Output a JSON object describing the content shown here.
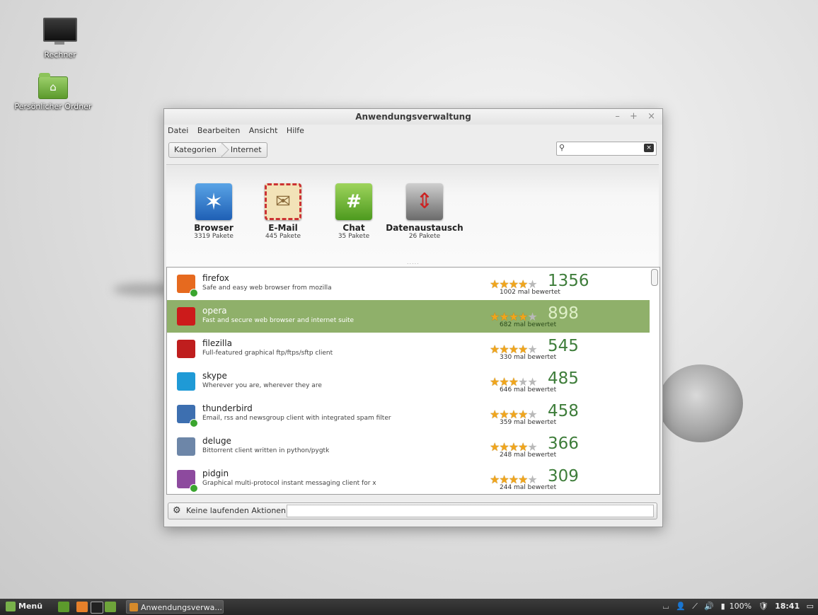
{
  "desktop": {
    "icons": [
      {
        "label": "Rechner"
      },
      {
        "label": "Persönlicher Ordner"
      }
    ]
  },
  "window": {
    "title": "Anwendungsverwaltung",
    "controls": {
      "minimize": "–",
      "maximize": "+",
      "close": "×"
    },
    "menu": [
      "Datei",
      "Bearbeiten",
      "Ansicht",
      "Hilfe"
    ],
    "breadcrumb": [
      "Kategorien",
      "Internet"
    ],
    "search": {
      "value": "",
      "placeholder": ""
    },
    "grip": ".....",
    "categories": [
      {
        "name": "Browser",
        "count": "3319 Pakete",
        "icon": "browser-icon"
      },
      {
        "name": "E-Mail",
        "count": "445 Pakete",
        "icon": "mail-icon"
      },
      {
        "name": "Chat",
        "count": "35 Pakete",
        "icon": "chat-icon"
      },
      {
        "name": "Datenaustausch",
        "count": "26 Pakete",
        "icon": "file-transfer-icon"
      }
    ],
    "apps": [
      {
        "name": "firefox",
        "desc": "Safe and easy web browser from mozilla",
        "score": "1356",
        "votes": "1002 mal bewertet",
        "stars": 4,
        "installed": true,
        "icon_color": "#e66a1f",
        "selected": false
      },
      {
        "name": "opera",
        "desc": "Fast and secure web browser and internet suite",
        "score": "898",
        "votes": "682 mal bewertet",
        "stars": 4,
        "installed": false,
        "icon_color": "#cc1b1b",
        "selected": true
      },
      {
        "name": "filezilla",
        "desc": "Full-featured graphical ftp/ftps/sftp client",
        "score": "545",
        "votes": "330 mal bewertet",
        "stars": 4,
        "installed": false,
        "icon_color": "#bf1e1e",
        "selected": false
      },
      {
        "name": "skype",
        "desc": "Wherever you are, wherever they are",
        "score": "485",
        "votes": "646 mal bewertet",
        "stars": 3,
        "installed": false,
        "icon_color": "#1f9ad6",
        "selected": false
      },
      {
        "name": "thunderbird",
        "desc": "Email, rss and newsgroup client with integrated spam filter",
        "score": "458",
        "votes": "359 mal bewertet",
        "stars": 4,
        "installed": true,
        "icon_color": "#3d6fb0",
        "selected": false
      },
      {
        "name": "deluge",
        "desc": "Bittorrent client written in python/pygtk",
        "score": "366",
        "votes": "248 mal bewertet",
        "stars": 4,
        "installed": false,
        "icon_color": "#6d86a8",
        "selected": false
      },
      {
        "name": "pidgin",
        "desc": "Graphical multi-protocol instant messaging client for x",
        "score": "309",
        "votes": "244 mal bewertet",
        "stars": 4,
        "installed": true,
        "icon_color": "#8d4a9e",
        "selected": false
      }
    ],
    "status": {
      "text": "Keine laufenden Aktionen"
    }
  },
  "taskbar": {
    "menu_label": "Menü",
    "task_label": "Anwendungsverwa...",
    "battery": "100%",
    "clock": "18:41"
  },
  "colors": {
    "accent_green": "#8fb06a",
    "score_green": "#3e7d3a",
    "star": "#f0a51d"
  }
}
